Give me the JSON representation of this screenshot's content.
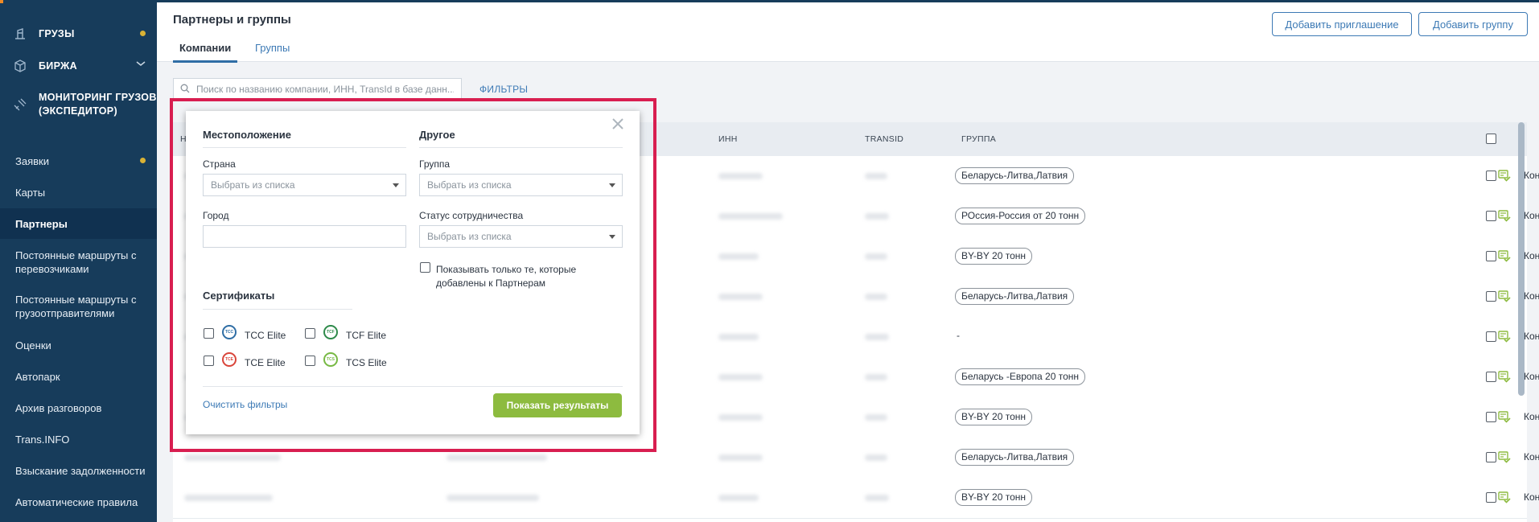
{
  "sidebar": {
    "main_items": [
      {
        "label": "ГРУЗЫ",
        "icon": "scale-icon",
        "has_dot": true
      },
      {
        "label": "БИРЖА",
        "icon": "cube-icon",
        "has_chevron": true
      },
      {
        "label_line1": "МОНИТОРИНГ ГРУЗОВ",
        "label_line2": "(ЭКСПЕДИТОР)",
        "icon": "satellite-icon"
      }
    ],
    "sub_items": [
      {
        "label": "Заявки",
        "has_dot": true
      },
      {
        "label": "Карты"
      },
      {
        "label": "Партнеры",
        "active": true
      },
      {
        "label_line1": "Постоянные маршруты с",
        "label_line2": "перевозчиками"
      },
      {
        "label_line1": "Постоянные маршруты с",
        "label_line2": "грузоотправителями"
      },
      {
        "label": "Оценки"
      },
      {
        "label": "Автопарк"
      },
      {
        "label": "Архив разговоров"
      },
      {
        "label": "Trans.INFO"
      },
      {
        "label": "Взыскание задолженности"
      },
      {
        "label": "Автоматические правила"
      }
    ]
  },
  "header": {
    "title": "Партнеры и группы",
    "tabs": [
      {
        "label": "Компании",
        "active": true
      },
      {
        "label": "Группы"
      }
    ],
    "invite_button": "Добавить приглашение",
    "add_group_button": "Добавить группу"
  },
  "search": {
    "placeholder": "Поиск по названию компании, ИНН, TransId в базе данн...",
    "filters_label": "ФИЛЬТРЫ"
  },
  "table": {
    "columns": {
      "first": "Н",
      "inn": "ИНН",
      "transid": "TRANSID",
      "group": "ГРУППА"
    },
    "rows": [
      {
        "group": "Беларусь-Литва,Латвия",
        "type": "Контрагент"
      },
      {
        "group": "РОссия-Россия от 20 тонн",
        "type": "Контрагент"
      },
      {
        "group": "BY-BY 20 тонн",
        "type": "Контрагент"
      },
      {
        "group": "Беларусь-Литва,Латвия",
        "type": "Контрагент"
      },
      {
        "group": "-",
        "type": "Контрагент"
      },
      {
        "group": "Беларусь -Европа 20 тонн",
        "type": "Контрагент"
      },
      {
        "group": "BY-BY 20 тонн",
        "type": "Контрагент"
      },
      {
        "group": "Беларусь-Литва,Латвия",
        "type": "Контрагент"
      },
      {
        "group": "BY-BY 20 тонн",
        "type": "Контрагент"
      }
    ]
  },
  "filter_popup": {
    "location_title": "Местоположение",
    "other_title": "Другое",
    "country_label": "Страна",
    "country_placeholder": "Выбрать из списка",
    "city_label": "Город",
    "group_label": "Группа",
    "group_placeholder": "Выбрать из списка",
    "status_label": "Статус сотрудничества",
    "status_placeholder": "Выбрать из списка",
    "partners_only_line1": "Показывать только те, которые",
    "partners_only_line2": "добавлены к Партнерам",
    "certs_title": "Сертификаты",
    "certs": [
      {
        "label": "TCC Elite",
        "badge": "TCC",
        "color": "#2f6ea5"
      },
      {
        "label": "TCF Elite",
        "badge": "TCF",
        "color": "#2e8a4a"
      },
      {
        "label": "TCE Elite",
        "badge": "TCE",
        "color": "#d9453a"
      },
      {
        "label": "TCS Elite",
        "badge": "TCS",
        "color": "#77b944"
      }
    ],
    "clear_label": "Очистить фильтры",
    "show_label": "Показать результаты"
  },
  "colors": {
    "sidebar": "#173c5b",
    "accent": "#3d7ab5",
    "green": "#8dbb3f",
    "highlight": "#d81e50"
  }
}
